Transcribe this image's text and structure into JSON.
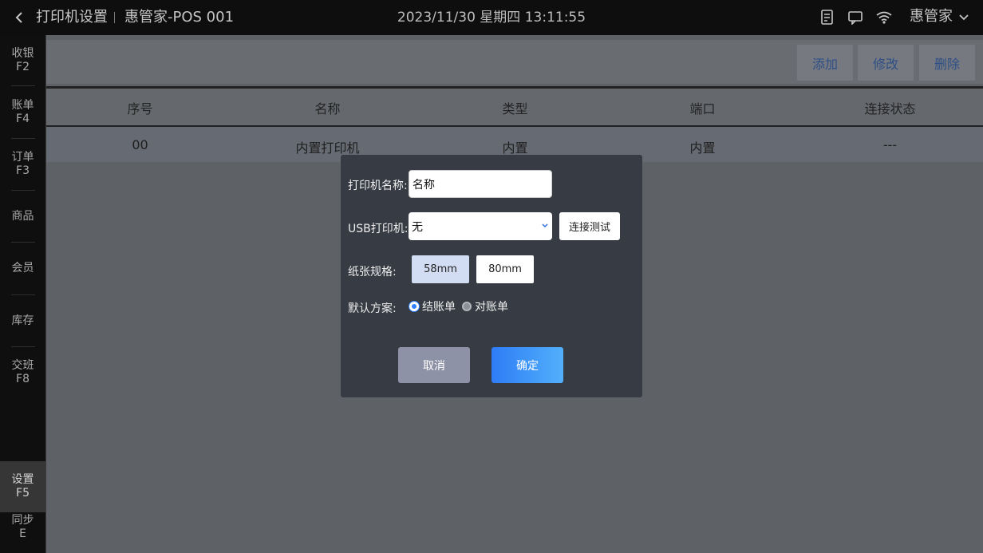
{
  "header": {
    "title": "打印机设置",
    "store": "惠管家-POS 001",
    "datetime": "2023/11/30 星期四 13:11:55",
    "user": "惠管家"
  },
  "sidebar": {
    "items": [
      {
        "label": "收银",
        "key": "F2"
      },
      {
        "label": "账单",
        "key": "F4"
      },
      {
        "label": "订单",
        "key": "F3"
      },
      {
        "label": "商品",
        "key": ""
      },
      {
        "label": "会员",
        "key": ""
      },
      {
        "label": "库存",
        "key": ""
      },
      {
        "label": "交班",
        "key": "F8"
      },
      {
        "label": "设置",
        "key": "F5"
      },
      {
        "label": "同步",
        "key": "E"
      }
    ]
  },
  "toolbar": {
    "add": "添加",
    "edit": "修改",
    "delete": "删除"
  },
  "table": {
    "columns": [
      "序号",
      "名称",
      "类型",
      "端口",
      "连接状态"
    ],
    "rows": [
      [
        "00",
        "内置打印机",
        "内置",
        "内置",
        "---"
      ]
    ]
  },
  "dialog": {
    "name_label": "打印机名称:",
    "name_value": "名称",
    "usb_label": "USB打印机:",
    "usb_value": "无",
    "test_button": "连接测试",
    "paper_label": "纸张规格:",
    "paper_options": [
      "58mm",
      "80mm"
    ],
    "scheme_label": "默认方案:",
    "scheme_options": [
      "结账单",
      "对账单"
    ],
    "cancel": "取消",
    "confirm": "确定"
  }
}
